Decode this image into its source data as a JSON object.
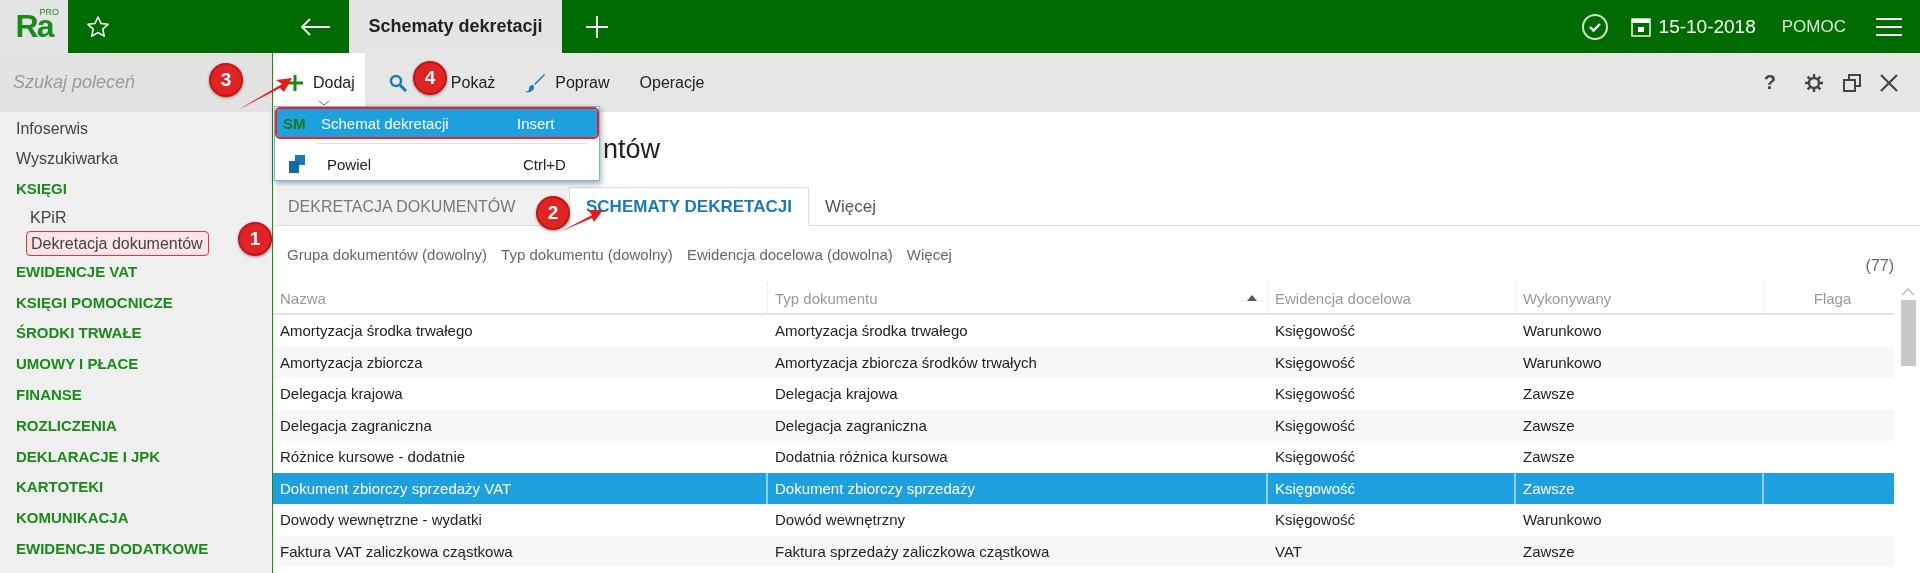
{
  "app": {
    "logo": "Ra",
    "logo_badge": "PRO"
  },
  "top_bar": {
    "tab_title": "Schematy dekretacji",
    "date": "15-10-2018",
    "help": "POMOC"
  },
  "sidebar": {
    "search_placeholder": "Szukaj poleceń",
    "items": [
      {
        "label": "Infoserwis",
        "kind": "link"
      },
      {
        "label": "Wyszukiwarka",
        "kind": "link"
      },
      {
        "label": "KSIĘGI",
        "kind": "section",
        "children": [
          {
            "label": "KPiR",
            "highlighted": false
          },
          {
            "label": "Dekretacja dokumentów",
            "highlighted": true
          }
        ]
      },
      {
        "label": "EWIDENCJE VAT",
        "kind": "section"
      },
      {
        "label": "KSIĘGI POMOCNICZE",
        "kind": "section"
      },
      {
        "label": "ŚRODKI TRWAŁE",
        "kind": "section"
      },
      {
        "label": "UMOWY I PŁACE",
        "kind": "section"
      },
      {
        "label": "FINANSE",
        "kind": "section"
      },
      {
        "label": "ROZLICZENIA",
        "kind": "section"
      },
      {
        "label": "DEKLARACJE I JPK",
        "kind": "section"
      },
      {
        "label": "KARTOTEKI",
        "kind": "section"
      },
      {
        "label": "KOMUNIKACJA",
        "kind": "section"
      },
      {
        "label": "EWIDENCJE DODATKOWE",
        "kind": "section"
      }
    ]
  },
  "toolbar": {
    "buttons": [
      {
        "label": "Dodaj",
        "kind": "add",
        "open": true
      },
      {
        "label": "Pokaż",
        "kind": "view",
        "open": false
      },
      {
        "label": "Popraw",
        "kind": "edit",
        "open": false
      },
      {
        "label": "Operacje",
        "kind": "plain",
        "open": false
      }
    ],
    "help": "?"
  },
  "dropdown_menu": {
    "items": [
      {
        "label": "Schemat dekretacji",
        "icon_text": "SM",
        "shortcut": "Insert",
        "selected": true,
        "highlighted": true
      },
      {
        "label": "Powiel",
        "shortcut": "Ctrl+D",
        "selected": false,
        "highlighted": false
      }
    ]
  },
  "page_title": "ntów",
  "tabs": [
    {
      "label": "DEKRETACJA DOKUMENTÓW",
      "selected": false
    },
    {
      "label": "SCHEMATY DEKRETACJI",
      "selected": true
    },
    {
      "label": "Więcej",
      "selected": false
    }
  ],
  "filters": [
    "Grupa dokumentów (dowolny)",
    "Typ dokumentu (dowolny)",
    "Ewidencja docelowa (dowolna)",
    "Więcej"
  ],
  "count": "(77)",
  "table": {
    "columns": [
      {
        "label": "Nazwa",
        "sorted": false
      },
      {
        "label": "Typ dokumentu",
        "sorted": true
      },
      {
        "label": "Ewidencja docelowa",
        "sorted": false
      },
      {
        "label": "Wykonywany",
        "sorted": false
      },
      {
        "label": "Flaga",
        "sorted": false
      }
    ],
    "rows": [
      {
        "cells": [
          "Amortyzacja środka trwałego",
          "Amortyzacja środka trwałego",
          "Księgowość",
          "Warunkowo"
        ],
        "selected": false
      },
      {
        "cells": [
          "Amortyzacja zbiorcza",
          "Amortyzacja zbiorcza środków trwałych",
          "Księgowość",
          "Warunkowo"
        ],
        "selected": false
      },
      {
        "cells": [
          "Delegacja krajowa",
          "Delegacja krajowa",
          "Księgowość",
          "Zawsze"
        ],
        "selected": false
      },
      {
        "cells": [
          "Delegacja zagraniczna",
          "Delegacja zagraniczna",
          "Księgowość",
          "Zawsze"
        ],
        "selected": false
      },
      {
        "cells": [
          "Różnice kursowe - dodatnie",
          "Dodatnia różnica kursowa",
          "Księgowość",
          "Zawsze"
        ],
        "selected": false
      },
      {
        "cells": [
          "Dokument zbiorczy sprzedaży VAT",
          "Dokument zbiorczy sprzedaży",
          "Księgowość",
          "Zawsze"
        ],
        "selected": true
      },
      {
        "cells": [
          "Dowody wewnętrzne - wydatki",
          "Dowód wewnętrzny",
          "Księgowość",
          "Warunkowo"
        ],
        "selected": false
      },
      {
        "cells": [
          "Faktura VAT zaliczkowa cząstkowa",
          "Faktura sprzedaży zaliczkowa cząstkowa",
          "VAT",
          "Zawsze"
        ],
        "selected": false
      }
    ]
  },
  "callouts": [
    "1",
    "2",
    "3",
    "4"
  ]
}
